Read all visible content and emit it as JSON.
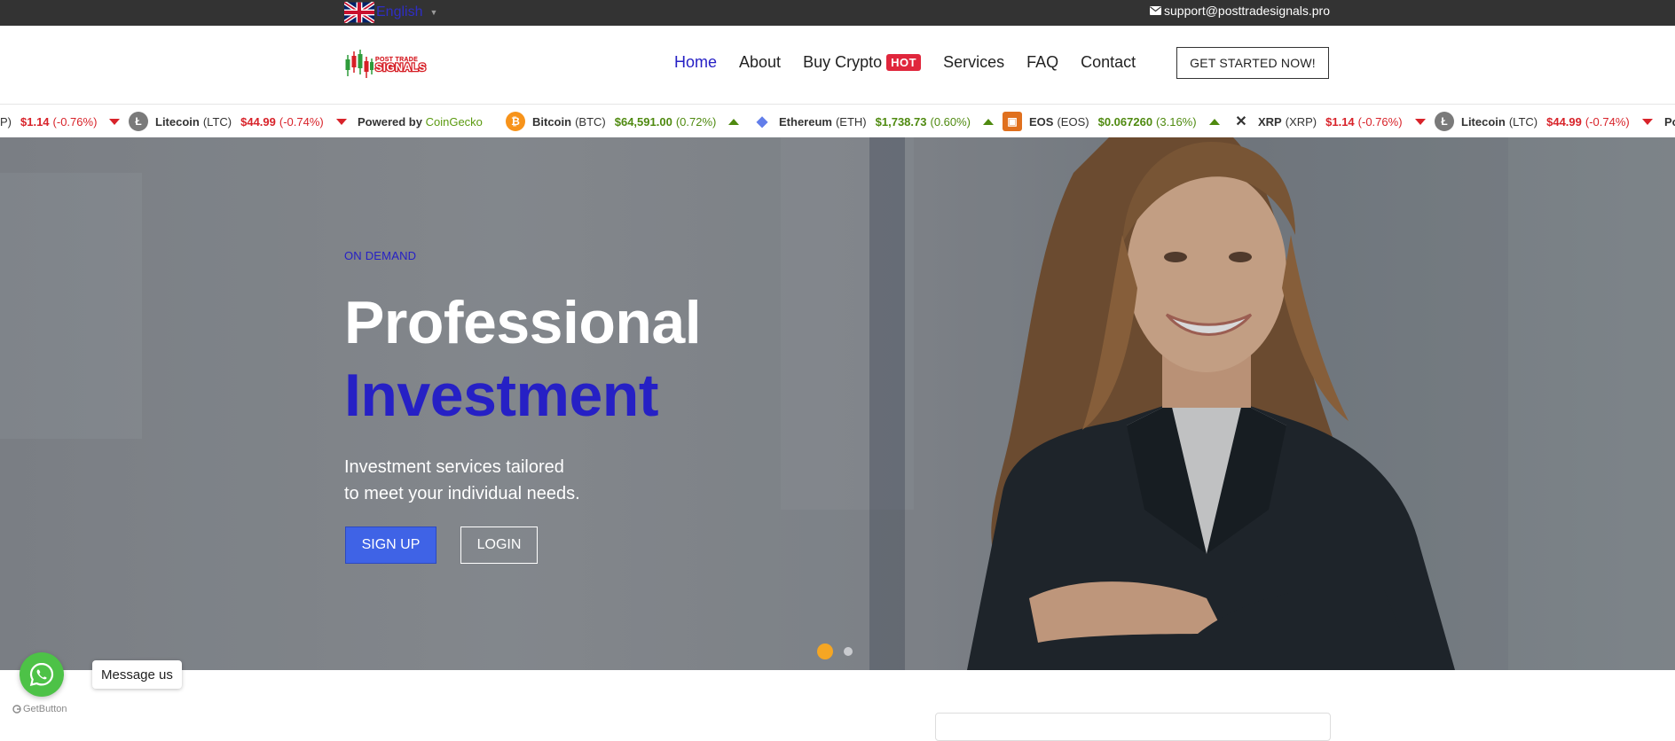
{
  "topbar": {
    "language": "English",
    "support_email": "support@posttradesignals.pro"
  },
  "logo": {
    "line1": "POST TRADE",
    "line2": "SIGNALS"
  },
  "nav": {
    "items": [
      {
        "label": "Home"
      },
      {
        "label": "About"
      },
      {
        "label": "Buy Crypto",
        "badge": "HOT"
      },
      {
        "label": "Services"
      },
      {
        "label": "FAQ"
      },
      {
        "label": "Contact"
      }
    ],
    "cta": "GET STARTED NOW!"
  },
  "ticker": {
    "powered_label": "Powered by",
    "powered_brand": "CoinGecko",
    "partial_left": {
      "sym": "P)",
      "price": "$1.14",
      "change": "(-0.76%)"
    },
    "partial_right": "Po",
    "coins": [
      {
        "name": "Litecoin",
        "sym": "(LTC)",
        "price": "$44.99",
        "change": "(-0.74%)",
        "direction": "down",
        "icon": "litecoin-icon",
        "color": "#7a7a7a",
        "glyph": "Ł"
      },
      {
        "name": "Bitcoin",
        "sym": "(BTC)",
        "price": "$64,591.00",
        "change": "(0.72%)",
        "direction": "up",
        "icon": "bitcoin-icon",
        "color": "#f7931a",
        "glyph": "₿"
      },
      {
        "name": "Ethereum",
        "sym": "(ETH)",
        "price": "$1,738.73",
        "change": "(0.60%)",
        "direction": "up",
        "icon": "ethereum-icon",
        "color": "#627eea",
        "glyph": "◆"
      },
      {
        "name": "EOS",
        "sym": "(EOS)",
        "price": "$0.067260",
        "change": "(3.16%)",
        "direction": "up",
        "icon": "eos-icon",
        "color": "#e0701e",
        "glyph": "▣"
      },
      {
        "name": "XRP",
        "sym": "(XRP)",
        "price": "$1.14",
        "change": "(-0.76%)",
        "direction": "down",
        "icon": "xrp-icon",
        "color": "#333333",
        "glyph": "✕"
      },
      {
        "name": "Litecoin",
        "sym": "(LTC)",
        "price": "$44.99",
        "change": "(-0.74%)",
        "direction": "down",
        "icon": "litecoin-icon",
        "color": "#7a7a7a",
        "glyph": "Ł"
      }
    ]
  },
  "hero": {
    "eyebrow": "ON DEMAND",
    "title_line1": "Professional",
    "title_line2": "Investment",
    "subtitle_line1": "Investment services tailored",
    "subtitle_line2": "to meet your individual needs.",
    "signup": "SIGN UP",
    "login": "LOGIN",
    "slides_total": 2,
    "slide_active": 1
  },
  "widget": {
    "message": "Message us",
    "powered": "GetButton"
  },
  "colors": {
    "brand_blue": "#2620c5",
    "signup_blue": "#3f63e6",
    "hot_red": "#e0263c",
    "up_green": "#4f8a10",
    "down_red": "#d8232a",
    "whatsapp_green": "#4dc247",
    "slider_active": "#f5a623"
  }
}
